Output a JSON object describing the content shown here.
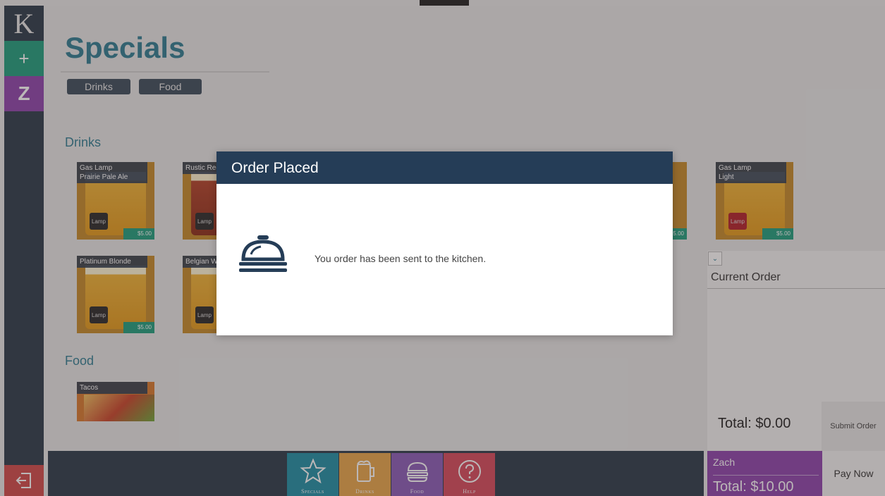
{
  "rail": {
    "brand_letter": "K",
    "add_symbol": "+",
    "user_letter": "Z"
  },
  "page": {
    "title": "Specials",
    "filters": [
      "Drinks",
      "Food"
    ],
    "sections": {
      "drinks": "Drinks",
      "food": "Food"
    }
  },
  "drinks": [
    {
      "name_line1": "Gas Lamp",
      "name_line2": "Prairie Pale Ale",
      "price": "$5.00",
      "logo": "Lamp"
    },
    {
      "name_line1": "Rustic Red",
      "name_line2": "",
      "price": "",
      "logo": "Lamp"
    },
    {
      "name_line1": "Gas Lamp",
      "name_line2": "Light",
      "price": "$5.00",
      "logo": "Lamp"
    },
    {
      "name_line1": "Platinum Blonde",
      "name_line2": "",
      "price": "$5.00",
      "logo": "Lamp"
    },
    {
      "name_line1": "Belgian Wh",
      "name_line2": "",
      "price": "",
      "logo": "Lamp"
    }
  ],
  "partial_price": "5.00",
  "food": [
    {
      "name_line1": "Tacos"
    }
  ],
  "order": {
    "header": "Current Order",
    "total": "Total: $0.00",
    "submit_label": "Submit Order",
    "user_name": "Zach",
    "user_total": "Total: $10.00",
    "pay_label": "Pay Now"
  },
  "nav": {
    "specials": "Specials",
    "drinks": "Drinks",
    "food": "Food",
    "help": "Help"
  },
  "modal": {
    "title": "Order Placed",
    "message": "You order has been sent to the kitchen.",
    "icon": "service-bell-icon"
  },
  "colors": {
    "accent_teal": "#2f7d93",
    "rail_dark": "#2c3b4a",
    "green": "#1f9e7e",
    "purple": "#8e44ad",
    "modal_header": "#253d57"
  }
}
